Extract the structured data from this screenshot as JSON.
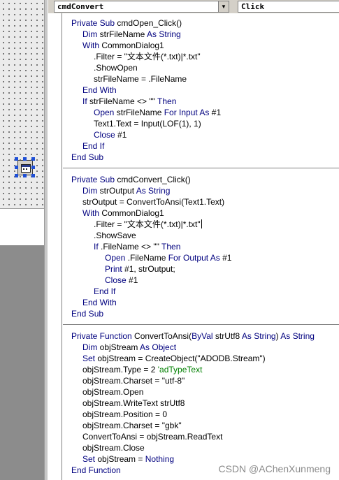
{
  "object_combo": {
    "value": "cmdConvert"
  },
  "procedure_combo": {
    "value": "Click"
  },
  "code_lines": [
    {
      "indent": 0,
      "parts": [
        {
          "t": "Private Sub ",
          "c": "kw"
        },
        {
          "t": "cmdOpen_Click()",
          "c": ""
        }
      ]
    },
    {
      "indent": 1,
      "parts": [
        {
          "t": "Dim ",
          "c": "kw"
        },
        {
          "t": "strFileName ",
          "c": ""
        },
        {
          "t": "As String",
          "c": "kw"
        }
      ]
    },
    {
      "indent": 1,
      "parts": [
        {
          "t": "With ",
          "c": "kw"
        },
        {
          "t": "CommonDialog1",
          "c": ""
        }
      ]
    },
    {
      "indent": 2,
      "parts": [
        {
          "t": ".Filter = \"文本文件(*.txt)|*.txt\"",
          "c": ""
        }
      ]
    },
    {
      "indent": 2,
      "parts": [
        {
          "t": ".ShowOpen",
          "c": ""
        }
      ]
    },
    {
      "indent": 2,
      "parts": [
        {
          "t": "strFileName = .FileName",
          "c": ""
        }
      ]
    },
    {
      "indent": 1,
      "parts": [
        {
          "t": "End With",
          "c": "kw"
        }
      ]
    },
    {
      "indent": 1,
      "parts": [
        {
          "t": "If ",
          "c": "kw"
        },
        {
          "t": "strFileName <> \"\" ",
          "c": ""
        },
        {
          "t": "Then",
          "c": "kw"
        }
      ]
    },
    {
      "indent": 2,
      "parts": [
        {
          "t": "Open ",
          "c": "kw"
        },
        {
          "t": "strFileName ",
          "c": ""
        },
        {
          "t": "For Input As ",
          "c": "kw"
        },
        {
          "t": "#1",
          "c": ""
        }
      ]
    },
    {
      "indent": 2,
      "parts": [
        {
          "t": "Text1.Text = Input(LOF(1), 1)",
          "c": ""
        }
      ]
    },
    {
      "indent": 2,
      "parts": [
        {
          "t": "Close ",
          "c": "kw"
        },
        {
          "t": "#1",
          "c": ""
        }
      ]
    },
    {
      "indent": 1,
      "parts": [
        {
          "t": "End If",
          "c": "kw"
        }
      ]
    },
    {
      "indent": 0,
      "parts": [
        {
          "t": "End Sub",
          "c": "kw"
        }
      ]
    },
    {
      "indent": 0,
      "parts": [],
      "separator": true
    },
    {
      "indent": 0,
      "parts": [
        {
          "t": "Private Sub ",
          "c": "kw"
        },
        {
          "t": "cmdConvert_Click()",
          "c": ""
        }
      ]
    },
    {
      "indent": 1,
      "parts": [
        {
          "t": "Dim ",
          "c": "kw"
        },
        {
          "t": "strOutput ",
          "c": ""
        },
        {
          "t": "As String",
          "c": "kw"
        }
      ]
    },
    {
      "indent": 1,
      "parts": [
        {
          "t": "strOutput = ConvertToAnsi(Text1.Text)",
          "c": ""
        }
      ]
    },
    {
      "indent": 1,
      "parts": [
        {
          "t": "With ",
          "c": "kw"
        },
        {
          "t": "CommonDialog1",
          "c": ""
        }
      ]
    },
    {
      "indent": 2,
      "parts": [
        {
          "t": ".Filter = \"文本文件(*.txt)|*.txt\"",
          "c": ""
        }
      ],
      "caret": true
    },
    {
      "indent": 2,
      "parts": [
        {
          "t": ".ShowSave",
          "c": ""
        }
      ]
    },
    {
      "indent": 2,
      "parts": [
        {
          "t": "If ",
          "c": "kw"
        },
        {
          "t": ".FileName <> \"\" ",
          "c": ""
        },
        {
          "t": "Then",
          "c": "kw"
        }
      ]
    },
    {
      "indent": 3,
      "parts": [
        {
          "t": "Open ",
          "c": "kw"
        },
        {
          "t": ".FileName ",
          "c": ""
        },
        {
          "t": "For Output As ",
          "c": "kw"
        },
        {
          "t": "#1",
          "c": ""
        }
      ]
    },
    {
      "indent": 3,
      "parts": [
        {
          "t": "Print ",
          "c": "kw"
        },
        {
          "t": "#1, strOutput;",
          "c": ""
        }
      ]
    },
    {
      "indent": 3,
      "parts": [
        {
          "t": "Close ",
          "c": "kw"
        },
        {
          "t": "#1",
          "c": ""
        }
      ]
    },
    {
      "indent": 2,
      "parts": [
        {
          "t": "End If",
          "c": "kw"
        }
      ]
    },
    {
      "indent": 1,
      "parts": [
        {
          "t": "End With",
          "c": "kw"
        }
      ]
    },
    {
      "indent": 0,
      "parts": [
        {
          "t": "End Sub",
          "c": "kw"
        }
      ]
    },
    {
      "indent": 0,
      "parts": [],
      "separator": true
    },
    {
      "indent": 0,
      "parts": [
        {
          "t": "Private Function ",
          "c": "kw"
        },
        {
          "t": "ConvertToAnsi(",
          "c": ""
        },
        {
          "t": "ByVal ",
          "c": "kw"
        },
        {
          "t": "strUtf8 ",
          "c": ""
        },
        {
          "t": "As String",
          "c": "kw"
        },
        {
          "t": ") ",
          "c": ""
        },
        {
          "t": "As String",
          "c": "kw"
        }
      ]
    },
    {
      "indent": 1,
      "parts": [
        {
          "t": "Dim ",
          "c": "kw"
        },
        {
          "t": "objStream ",
          "c": ""
        },
        {
          "t": "As Object",
          "c": "kw"
        }
      ]
    },
    {
      "indent": 1,
      "parts": [
        {
          "t": "Set ",
          "c": "kw"
        },
        {
          "t": "objStream = CreateObject(\"ADODB.Stream\")",
          "c": ""
        }
      ]
    },
    {
      "indent": 1,
      "parts": [
        {
          "t": "objStream.Type = 2 ",
          "c": ""
        },
        {
          "t": "'adTypeText",
          "c": "cm"
        }
      ]
    },
    {
      "indent": 1,
      "parts": [
        {
          "t": "objStream.Charset = \"utf-8\"",
          "c": ""
        }
      ]
    },
    {
      "indent": 1,
      "parts": [
        {
          "t": "objStream.Open",
          "c": ""
        }
      ]
    },
    {
      "indent": 1,
      "parts": [
        {
          "t": "objStream.WriteText strUtf8",
          "c": ""
        }
      ]
    },
    {
      "indent": 1,
      "parts": [
        {
          "t": "objStream.Position = 0",
          "c": ""
        }
      ]
    },
    {
      "indent": 1,
      "parts": [
        {
          "t": "objStream.Charset = \"gbk\"",
          "c": ""
        }
      ]
    },
    {
      "indent": 1,
      "parts": [
        {
          "t": "ConvertToAnsi = objStream.ReadText",
          "c": ""
        }
      ]
    },
    {
      "indent": 1,
      "parts": [
        {
          "t": "objStream.Close",
          "c": ""
        }
      ]
    },
    {
      "indent": 1,
      "parts": [
        {
          "t": "Set ",
          "c": "kw"
        },
        {
          "t": "objStream = ",
          "c": ""
        },
        {
          "t": "Nothing",
          "c": "kw"
        }
      ]
    },
    {
      "indent": 0,
      "parts": [
        {
          "t": "End Function",
          "c": "kw"
        }
      ]
    }
  ],
  "watermark": "CSDN @AChenXunmeng",
  "colors": {
    "keyword": "#00007f",
    "comment": "#007f00",
    "text": "#000000"
  },
  "icons": {
    "form_control": "common-dialog-icon",
    "combo_arrow": "chevron-down-icon"
  }
}
